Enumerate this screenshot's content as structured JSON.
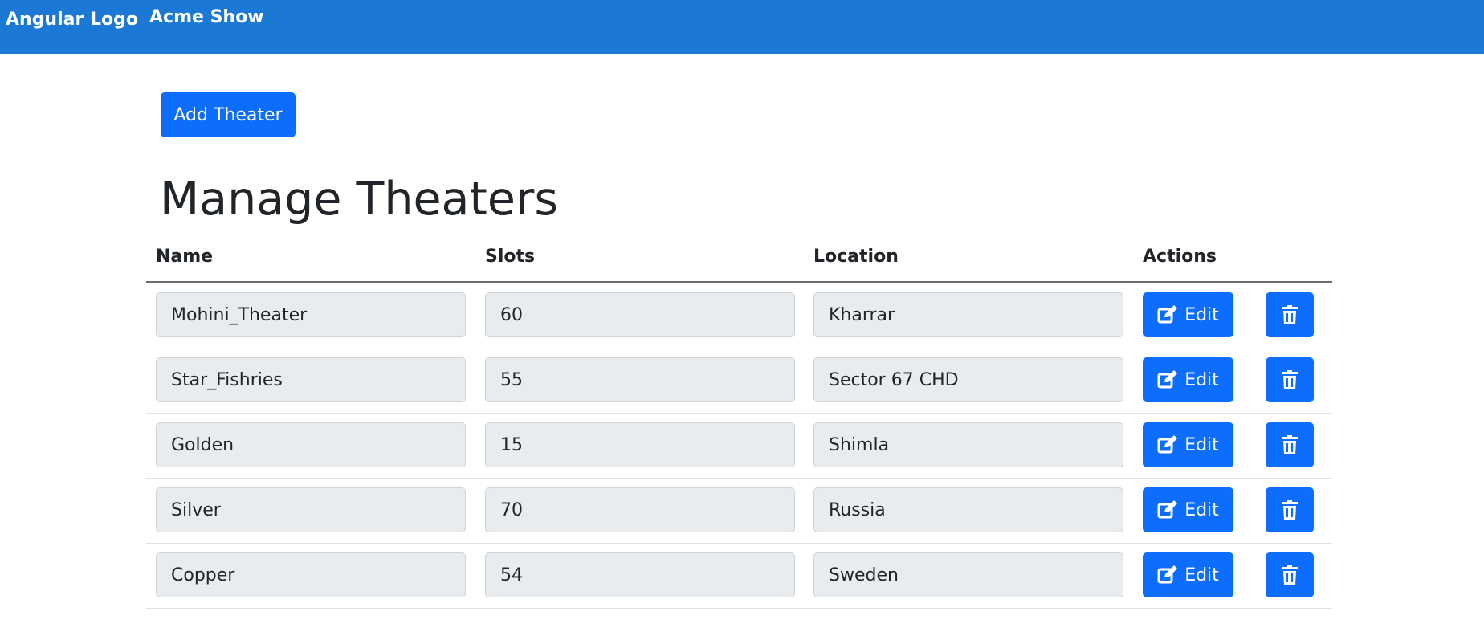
{
  "navbar": {
    "brand": "Angular Logo",
    "link": "Acme Show",
    "color": "#1b78d5"
  },
  "toolbar": {
    "add_label": "Add Theater"
  },
  "page": {
    "title": "Manage Theaters"
  },
  "table": {
    "headers": [
      "Name",
      "Slots",
      "Location",
      "Actions"
    ],
    "rows": [
      {
        "name": "Mohini_Theater",
        "slots": "60",
        "location": "Kharrar"
      },
      {
        "name": "Star_Fishries",
        "slots": "55",
        "location": "Sector 67 CHD"
      },
      {
        "name": "Golden",
        "slots": "15",
        "location": "Shimla"
      },
      {
        "name": "Silver",
        "slots": "70",
        "location": "Russia"
      },
      {
        "name": "Copper",
        "slots": "54",
        "location": "Sweden"
      }
    ],
    "edit_label": "Edit",
    "edit_icon": "edit-icon",
    "delete_icon": "trash-icon"
  },
  "colors": {
    "primary": "#0d6efd",
    "input_bg": "#e9ecef"
  }
}
